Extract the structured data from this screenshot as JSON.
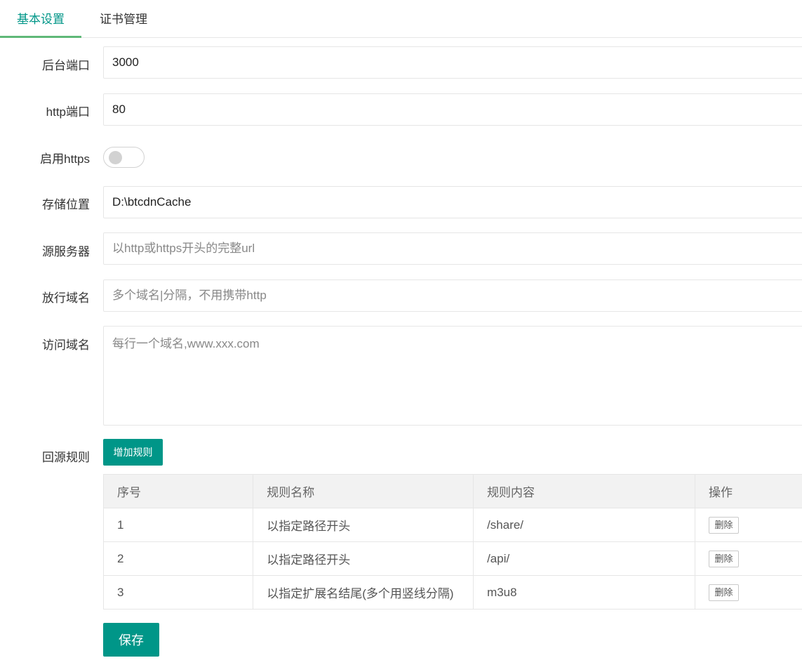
{
  "tabs": [
    {
      "label": "基本设置",
      "active": true
    },
    {
      "label": "证书管理",
      "active": false
    }
  ],
  "form": {
    "admin_port": {
      "label": "后台端口",
      "value": "3000"
    },
    "http_port": {
      "label": "http端口",
      "value": "80"
    },
    "https_enable": {
      "label": "启用https",
      "enabled": false
    },
    "storage": {
      "label": "存储位置",
      "value": "D:\\btcdnCache"
    },
    "origin_server": {
      "label": "源服务器",
      "value": "",
      "placeholder": "以http或https开头的完整url"
    },
    "allowed_domains": {
      "label": "放行域名",
      "value": "",
      "placeholder": "多个域名|分隔，不用携带http"
    },
    "access_domains": {
      "label": "访问域名",
      "value": "",
      "placeholder": "每行一个域名,www.xxx.com"
    },
    "back_to_source": {
      "label": "回源规则",
      "add_button": "增加规则"
    }
  },
  "rules_table": {
    "headers": [
      "序号",
      "规则名称",
      "规则内容",
      "操作"
    ],
    "rows": [
      {
        "index": "1",
        "name": "以指定路径开头",
        "content": "/share/",
        "action": "删除"
      },
      {
        "index": "2",
        "name": "以指定路径开头",
        "content": "/api/",
        "action": "删除"
      },
      {
        "index": "3",
        "name": "以指定扩展名结尾(多个用竖线分隔)",
        "content": "m3u8",
        "action": "删除"
      }
    ]
  },
  "save_button": "保存",
  "colors": {
    "accent": "#009688",
    "tab_underline": "#5fb878",
    "border": "#e6e6e6",
    "header_bg": "#f2f2f2"
  }
}
